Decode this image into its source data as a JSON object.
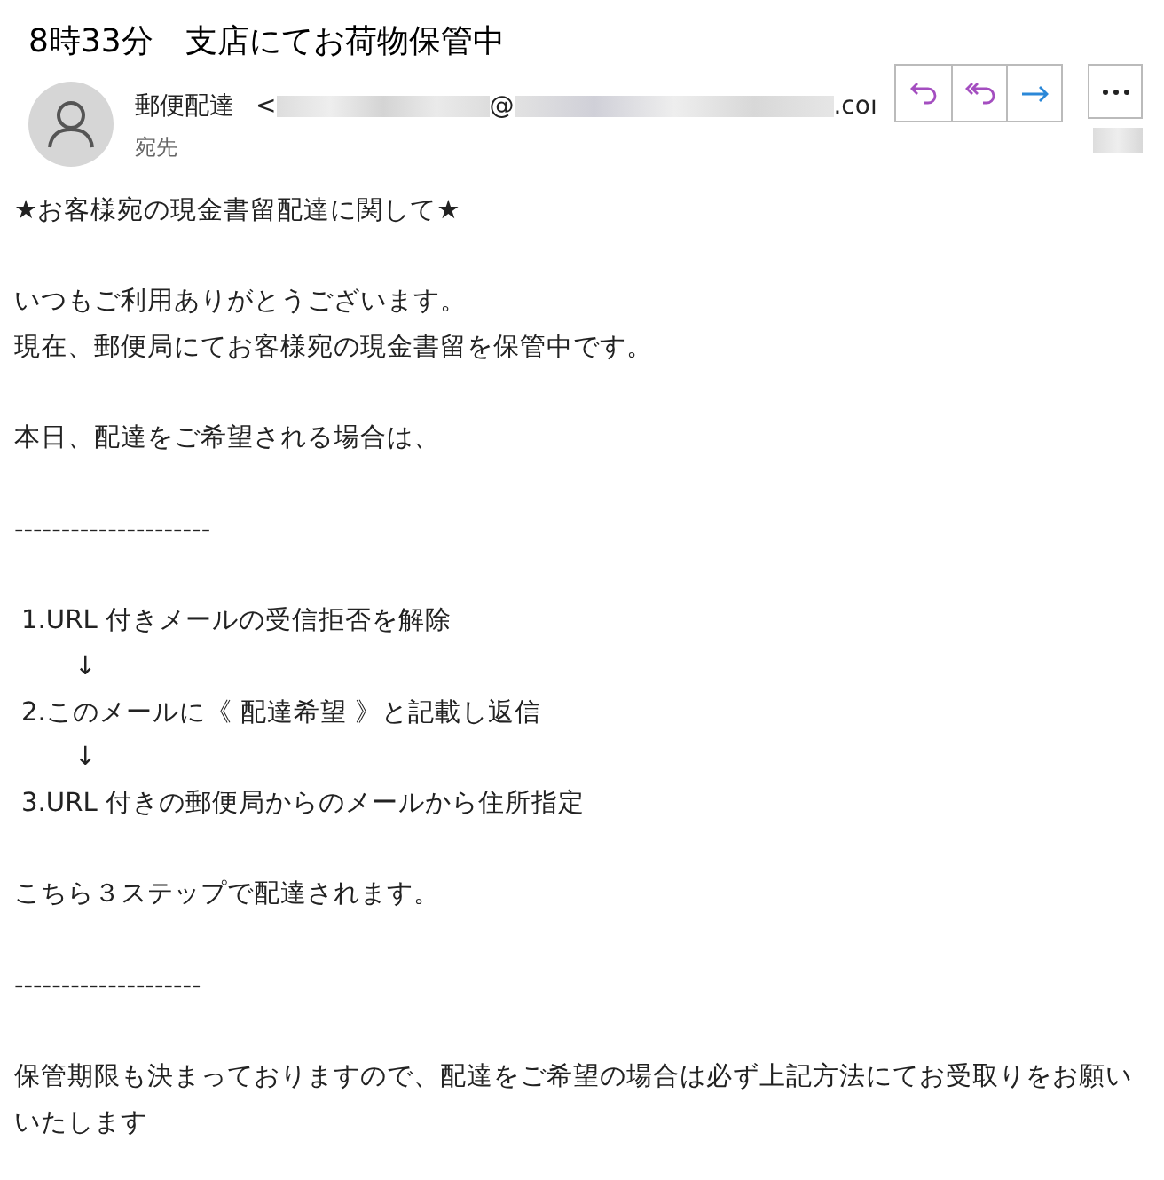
{
  "subject": "8時33分　支店にてお荷物保管中",
  "sender": {
    "name": "郵便配達",
    "open_bracket": "<",
    "at": "@",
    "domain_end": ".coı",
    "recipient_label": "宛先"
  },
  "actions": [
    {
      "kind": "reply"
    },
    {
      "kind": "reply_all"
    },
    {
      "kind": "forward"
    },
    {
      "kind": "more"
    }
  ],
  "body": [
    [
      {
        "kind": "text",
        "text": "★お客様宛の現金書留配達に関して★"
      }
    ],
    [
      {
        "kind": "text",
        "text": "いつもご利用ありがとうございます。"
      },
      {
        "kind": "text",
        "text": "現在、郵便局にてお客様宛の現金書留を保管中です。"
      }
    ],
    [
      {
        "kind": "text",
        "text": "本日、配達をご希望される場合は、"
      }
    ],
    [
      {
        "kind": "text",
        "text": "---------------------"
      }
    ],
    [
      {
        "kind": "step",
        "text": "1.URL 付きメールの受信拒否を解除"
      },
      {
        "kind": "arrow",
        "text": "↓"
      },
      {
        "kind": "step",
        "text": "2.このメールに《 配達希望 》と記載し返信"
      },
      {
        "kind": "arrow",
        "text": "↓"
      },
      {
        "kind": "step",
        "text": "3.URL 付きの郵便局からのメールから住所指定"
      }
    ],
    [
      {
        "kind": "text",
        "text": "こちら３ステップで配達されます。"
      }
    ],
    [
      {
        "kind": "text",
        "text": "--------------------"
      }
    ],
    [
      {
        "kind": "text",
        "text": "保管期限も決まっておりますので、配達をご希望の場合は必ず上記方法にてお受取りをお願いいたします"
      }
    ]
  ]
}
